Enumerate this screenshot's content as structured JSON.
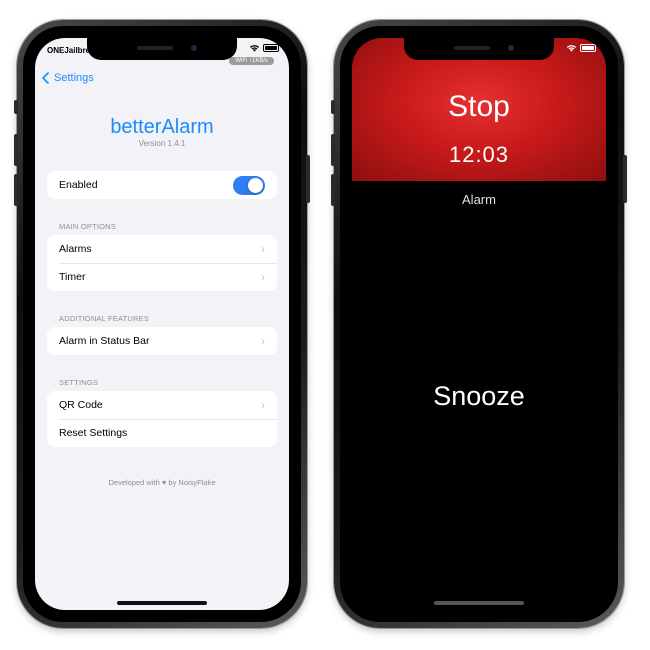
{
  "left_phone": {
    "status": {
      "carrier": "ONEJailbreak",
      "network_badge": "WiFi ↑1KB/s",
      "battery_level": 1.0
    },
    "nav": {
      "back_label": "Settings"
    },
    "app": {
      "title": "betterAlarm",
      "version": "Version 1.4.1"
    },
    "enabled": {
      "label": "Enabled",
      "value": true
    },
    "sections": {
      "main_options": {
        "header": "MAIN OPTIONS",
        "items": [
          {
            "label": "Alarms"
          },
          {
            "label": "Timer"
          }
        ]
      },
      "additional_features": {
        "header": "ADDITIONAL FEATURES",
        "items": [
          {
            "label": "Alarm in Status Bar"
          }
        ]
      },
      "settings": {
        "header": "SETTINGS",
        "items": [
          {
            "label": "QR Code"
          },
          {
            "label": "Reset Settings"
          }
        ]
      }
    },
    "footer": {
      "prefix": "Developed with",
      "suffix": "by NoisyFlake"
    }
  },
  "right_phone": {
    "status": {
      "battery_level": 1.0
    },
    "banner": {
      "stop_label": "Stop",
      "time": "12:03"
    },
    "alarm_name": "Alarm",
    "snooze_label": "Snooze",
    "colors": {
      "banner": "#d21f1f",
      "background": "#000000"
    }
  },
  "colors": {
    "accent": "#1a8cff",
    "toggle_on": "#2f7ff0",
    "group_bg": "#f2f2f7"
  }
}
